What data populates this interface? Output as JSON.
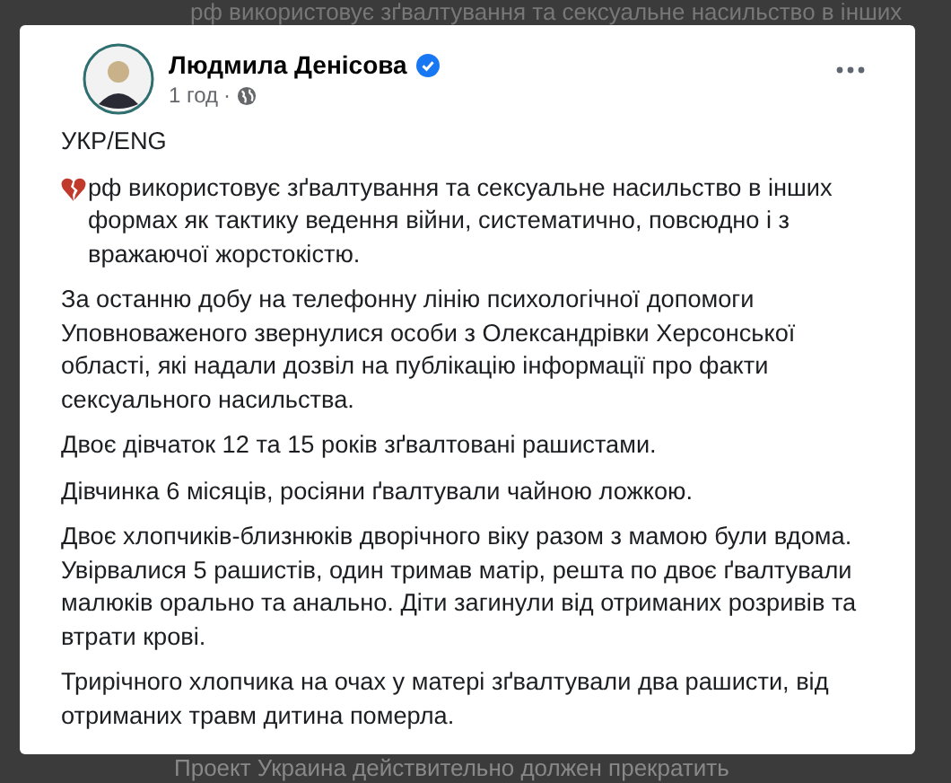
{
  "background_text_top": "рф використовує зґвалтування та сексуальне насильство в інших",
  "post": {
    "author": "Людмила Денісова",
    "verified": true,
    "time": "1 год",
    "separator": "·",
    "public": true,
    "paragraphs": [
      {
        "kind": "text",
        "text": "УКР/ENG"
      },
      {
        "kind": "heart",
        "text": "рф використовує зґвалтування та сексуальне насильство в інших формах як тактику ведення війни, систематично, повсюдно і з вражаючої жорстокістю."
      },
      {
        "kind": "text",
        "text": "За останню добу на телефонну лінію психологічної допомоги Уповноваженого звернулися особи з Олександрівки Херсонської області, які надали дозвіл на публікацію інформації про факти сексуального насильства."
      },
      {
        "kind": "text",
        "text": "Двоє дівчаток 12 та 15 років зґвалтовані рашистами."
      },
      {
        "kind": "text",
        "text": "Дівчинка 6 місяців, росіяни ґвалтували чайною ложкою."
      },
      {
        "kind": "text",
        "text": "Двоє хлопчиків-близнюків дворічного віку разом з мамою були вдома. Увірвалися 5 рашистів, один тримав матір, решта по двоє ґвалтували малюків орально та анально. Діти загинули від отриманих розривів та втрати крові."
      },
      {
        "kind": "text",
        "text": "Трирічного хлопчика на очах у матері зґвалтували два рашисти, від отриманих травм дитина померла."
      }
    ]
  },
  "background_text_bottom": "Проект Украина действительно должен прекратить"
}
